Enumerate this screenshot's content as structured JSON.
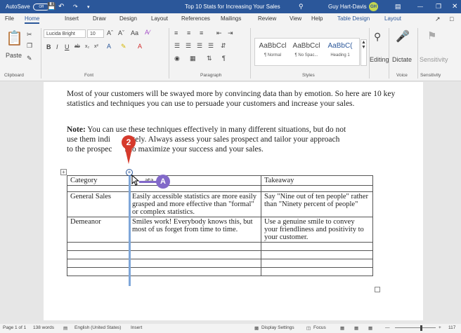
{
  "titlebar": {
    "autosave_label": "AutoSave",
    "autosave_state": "Off",
    "document_title": "Top 10 Stats for Increasing Your Sales",
    "user_name": "Guy Hart-Davis",
    "user_initials": "GH",
    "accent_color": "#2b579a"
  },
  "menu": {
    "tabs": [
      "File",
      "Home",
      "Insert",
      "Draw",
      "Design",
      "Layout",
      "References",
      "Mailings",
      "Review",
      "View",
      "Help",
      "Table Design",
      "Layout"
    ],
    "active": "Home"
  },
  "ribbon": {
    "font_name": "Lucida Bright",
    "font_size": "10",
    "paste_label": "Paste",
    "styles": [
      {
        "sample": "AaBbCcl",
        "name": "¶ Normal"
      },
      {
        "sample": "AaBbCcl",
        "name": "¶ No Spac..."
      },
      {
        "sample": "AaBbC(",
        "name": "Heading 1"
      }
    ],
    "editing_label": "Editing",
    "dictate_label": "Dictate",
    "sensitivity_label": "Sensitivity",
    "groups": [
      "Clipboard",
      "Font",
      "Paragraph",
      "Styles",
      "Voice",
      "Sensitivity"
    ]
  },
  "document": {
    "para1": "Most of your customers will be swayed more by convincing data than by emotion. So here are 10 key statistics and techniques you can use to persuade your customers and increase your sales.",
    "note_label": "Note:",
    "note_line1": " You can use these techniques effectively in many different situations, but do not",
    "note_line2": "use them indi",
    "note_line2_end": "mately. Always assess your sales prospect and tailor your approach",
    "note_line3": "to the prospec",
    "note_line3_end": "s to maximize your success and your sales.",
    "table": {
      "headers": [
        "Category",
        "ata",
        "Takeaway"
      ],
      "rows": [
        [
          "General Sales",
          "Easily accessible statistics are more easily grasped and more effective than \"formal\" or complex statistics.",
          "Say \"Nine out of ten people\" rather than \"Ninety percent of people\""
        ],
        [
          "Demeanor",
          "Smiles work! Everybody knows this, but most of us forget from time to time.",
          "Use a genuine smile to convey your friendliness and positivity to your customer."
        ]
      ]
    }
  },
  "callouts": {
    "step": "2",
    "marker": "A"
  },
  "status": {
    "page": "Page 1 of 1",
    "words": "138 words",
    "language": "English (United States)",
    "mode": "Insert",
    "display_settings": "Display Settings",
    "focus": "Focus",
    "zoom": "117"
  }
}
